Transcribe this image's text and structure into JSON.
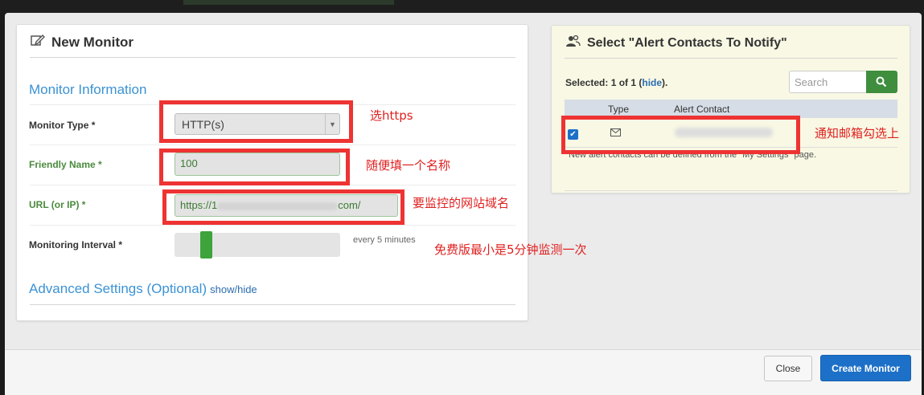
{
  "modal": {
    "left_panel": {
      "title": "New Monitor",
      "section_title": "Monitor Information",
      "monitor_type_label": "Monitor Type *",
      "monitor_type_value": "HTTP(s)",
      "friendly_name_label": "Friendly Name *",
      "friendly_name_value": "100",
      "url_label": "URL (or IP) *",
      "url_value_start": "https://1",
      "url_value_end": "com/",
      "interval_label": "Monitoring Interval *",
      "interval_hint": "every 5 minutes",
      "interval_minutes": 5,
      "advanced_title": "Advanced Settings (Optional)",
      "advanced_toggle": "show/hide"
    },
    "right_panel": {
      "title": "Select \"Alert Contacts To Notify\"",
      "selected_prefix": "Selected: 1 of 1 (",
      "selected_link": "hide",
      "selected_suffix": ").",
      "search_placeholder": "Search",
      "col_type": "Type",
      "col_contact": "Alert Contact",
      "footer_note": "New alert contacts can be defined from the \"My Settings\" page.",
      "row_checked": true
    },
    "footer": {
      "close_label": "Close",
      "create_label": "Create Monitor"
    }
  },
  "annotations": {
    "note_https": "选https",
    "note_name": "随便填一个名称",
    "note_url": "要监控的网站域名",
    "note_interval": "免费版最小是5分钟监测一次",
    "note_email": "通知邮箱勾选上"
  },
  "colors": {
    "accent_blue": "#1d70c8",
    "section_blue": "#3b92d4",
    "green": "#3ea33a",
    "annotation_red": "#ee3333"
  }
}
